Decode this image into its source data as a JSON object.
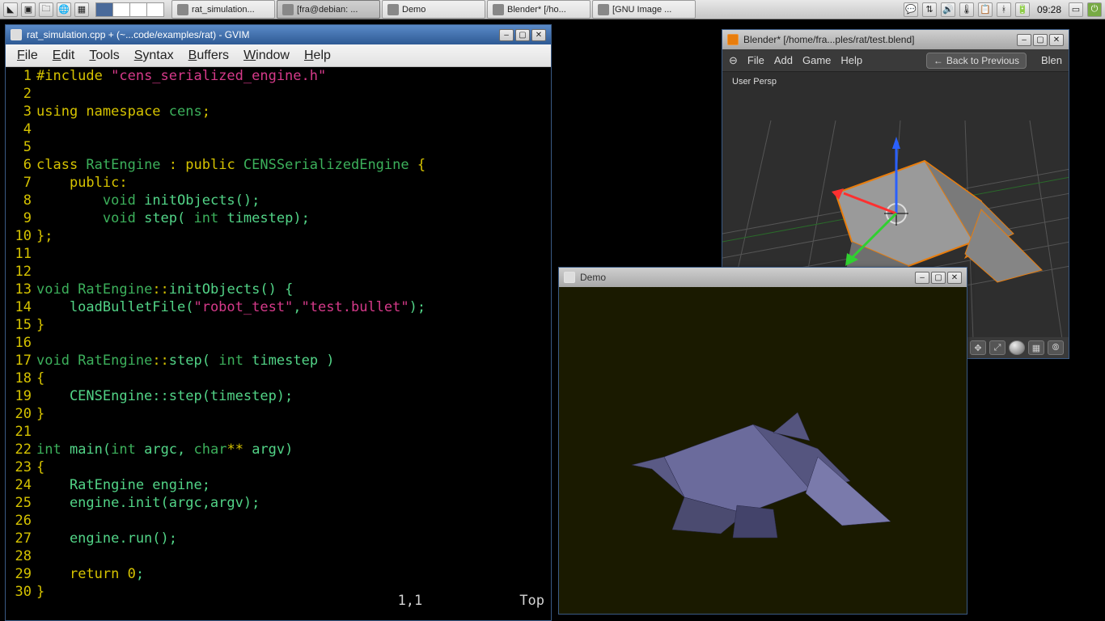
{
  "taskbar": {
    "tasks": [
      {
        "label": "rat_simulation...",
        "active": false
      },
      {
        "label": "[fra@debian: ...",
        "active": true
      },
      {
        "label": "Demo",
        "active": false
      },
      {
        "label": "Blender* [/ho...",
        "active": false
      },
      {
        "label": "[GNU Image ...",
        "active": false
      }
    ],
    "clock": "09:28"
  },
  "gvim": {
    "title": "rat_simulation.cpp + (~...code/examples/rat) - GVIM",
    "menu": [
      "File",
      "Edit",
      "Tools",
      "Syntax",
      "Buffers",
      "Window",
      "Help"
    ],
    "status_pos": "1,1",
    "status_scroll": "Top",
    "lines": [
      {
        "n": 1,
        "seg": [
          [
            "pl",
            "#include "
          ],
          [
            "str",
            "\"cens_serialized_engine.h\""
          ]
        ]
      },
      {
        "n": 2,
        "seg": []
      },
      {
        "n": 3,
        "seg": [
          [
            "kw",
            "using "
          ],
          [
            "kw",
            "namespace "
          ],
          [
            "ty",
            "cens"
          ],
          [
            "pl",
            ";"
          ]
        ]
      },
      {
        "n": 4,
        "seg": []
      },
      {
        "n": 5,
        "seg": []
      },
      {
        "n": 6,
        "seg": [
          [
            "kw",
            "class "
          ],
          [
            "ty",
            "RatEngine "
          ],
          [
            "pl",
            ": "
          ],
          [
            "kw",
            "public "
          ],
          [
            "ty",
            "CENSSerializedEngine "
          ],
          [
            "pl",
            "{"
          ]
        ]
      },
      {
        "n": 7,
        "seg": [
          [
            "pl",
            "    "
          ],
          [
            "kw",
            "public"
          ],
          [
            "pl",
            ":"
          ]
        ]
      },
      {
        "n": 8,
        "seg": [
          [
            "pl",
            "        "
          ],
          [
            "ty",
            "void "
          ],
          [
            "code",
            "initObjects();"
          ]
        ]
      },
      {
        "n": 9,
        "seg": [
          [
            "pl",
            "        "
          ],
          [
            "ty",
            "void "
          ],
          [
            "code",
            "step( "
          ],
          [
            "ty",
            "int "
          ],
          [
            "code",
            "timestep);"
          ]
        ]
      },
      {
        "n": 10,
        "seg": [
          [
            "pl",
            "};"
          ]
        ]
      },
      {
        "n": 11,
        "seg": []
      },
      {
        "n": 12,
        "seg": []
      },
      {
        "n": 13,
        "seg": [
          [
            "ty",
            "void "
          ],
          [
            "ty",
            "RatEngine"
          ],
          [
            "pl",
            "::"
          ],
          [
            "code",
            "initObjects() {"
          ]
        ]
      },
      {
        "n": 14,
        "seg": [
          [
            "code",
            "    loadBulletFile("
          ],
          [
            "str",
            "\"robot_test\""
          ],
          [
            "code",
            ","
          ],
          [
            "str",
            "\"test.bullet\""
          ],
          [
            "code",
            ");"
          ]
        ]
      },
      {
        "n": 15,
        "seg": [
          [
            "pl",
            "}"
          ]
        ]
      },
      {
        "n": 16,
        "seg": []
      },
      {
        "n": 17,
        "seg": [
          [
            "ty",
            "void "
          ],
          [
            "ty",
            "RatEngine"
          ],
          [
            "pl",
            "::"
          ],
          [
            "code",
            "step( "
          ],
          [
            "ty",
            "int "
          ],
          [
            "code",
            "timestep )"
          ]
        ]
      },
      {
        "n": 18,
        "seg": [
          [
            "pl",
            "{"
          ]
        ]
      },
      {
        "n": 19,
        "seg": [
          [
            "code",
            "    CENSEngine::step(timestep);"
          ]
        ]
      },
      {
        "n": 20,
        "seg": [
          [
            "pl",
            "}"
          ]
        ]
      },
      {
        "n": 21,
        "seg": []
      },
      {
        "n": 22,
        "seg": [
          [
            "ty",
            "int "
          ],
          [
            "code",
            "main("
          ],
          [
            "ty",
            "int "
          ],
          [
            "code",
            "argc, "
          ],
          [
            "ty",
            "char"
          ],
          [
            "pl",
            "** "
          ],
          [
            "code",
            "argv)"
          ]
        ]
      },
      {
        "n": 23,
        "seg": [
          [
            "pl",
            "{"
          ]
        ]
      },
      {
        "n": 24,
        "seg": [
          [
            "code",
            "    RatEngine engine;"
          ]
        ]
      },
      {
        "n": 25,
        "seg": [
          [
            "code",
            "    engine.init(argc,argv);"
          ]
        ]
      },
      {
        "n": 26,
        "seg": []
      },
      {
        "n": 27,
        "seg": [
          [
            "code",
            "    engine.run();"
          ]
        ]
      },
      {
        "n": 28,
        "seg": []
      },
      {
        "n": 29,
        "seg": [
          [
            "code",
            "    "
          ],
          [
            "kw",
            "return "
          ],
          [
            "pl",
            "0"
          ],
          [
            "code",
            ";"
          ]
        ]
      },
      {
        "n": 30,
        "seg": [
          [
            "pl",
            "}"
          ]
        ]
      }
    ]
  },
  "demo": {
    "title": "Demo"
  },
  "blender": {
    "title": "Blender* [/home/fra...ples/rat/test.blend]",
    "menu": [
      "File",
      "Add",
      "Game",
      "Help"
    ],
    "back_label": "Back to Previous",
    "blen_label": "Blen",
    "persp_label": "User Persp"
  }
}
